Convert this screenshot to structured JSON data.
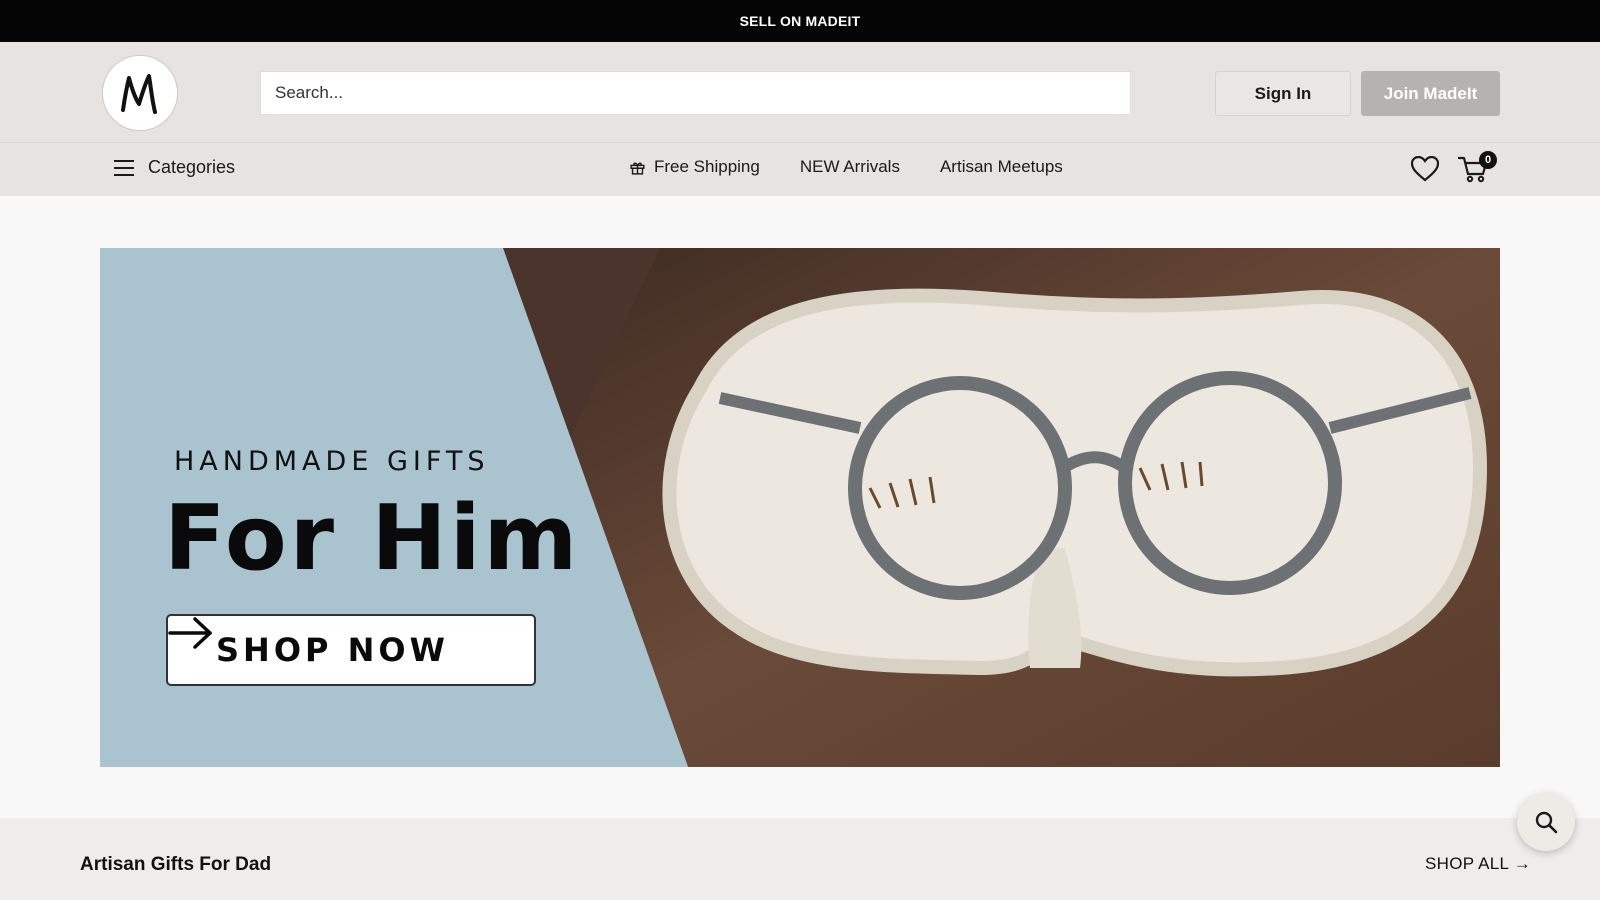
{
  "topbar": {
    "label": "SELL ON MADEIT"
  },
  "header": {
    "logo_letter": "M",
    "search_placeholder": "Search...",
    "signin_label": "Sign In",
    "join_label": "Join MadeIt"
  },
  "nav": {
    "categories_label": "Categories",
    "links": [
      {
        "label": "Free Shipping",
        "icon": "gift-icon"
      },
      {
        "label": "NEW Arrivals"
      },
      {
        "label": "Artisan Meetups"
      }
    ],
    "wishlist_icon": "heart-icon",
    "cart_icon": "cart-icon",
    "cart_count": "0"
  },
  "hero": {
    "subtitle": "HANDMADE GIFTS",
    "title": "For Him",
    "cta_label": "SHOP NOW",
    "image_description_icon": "glasses-tray-photo"
  },
  "section": {
    "title": "Artisan Gifts For Dad",
    "shop_all_label": "SHOP ALL →"
  },
  "colors": {
    "topbar_bg": "#050505",
    "header_bg": "#e6e3e0",
    "join_bg": "#b5b2af",
    "hero_panel": "#a9c4cf"
  }
}
